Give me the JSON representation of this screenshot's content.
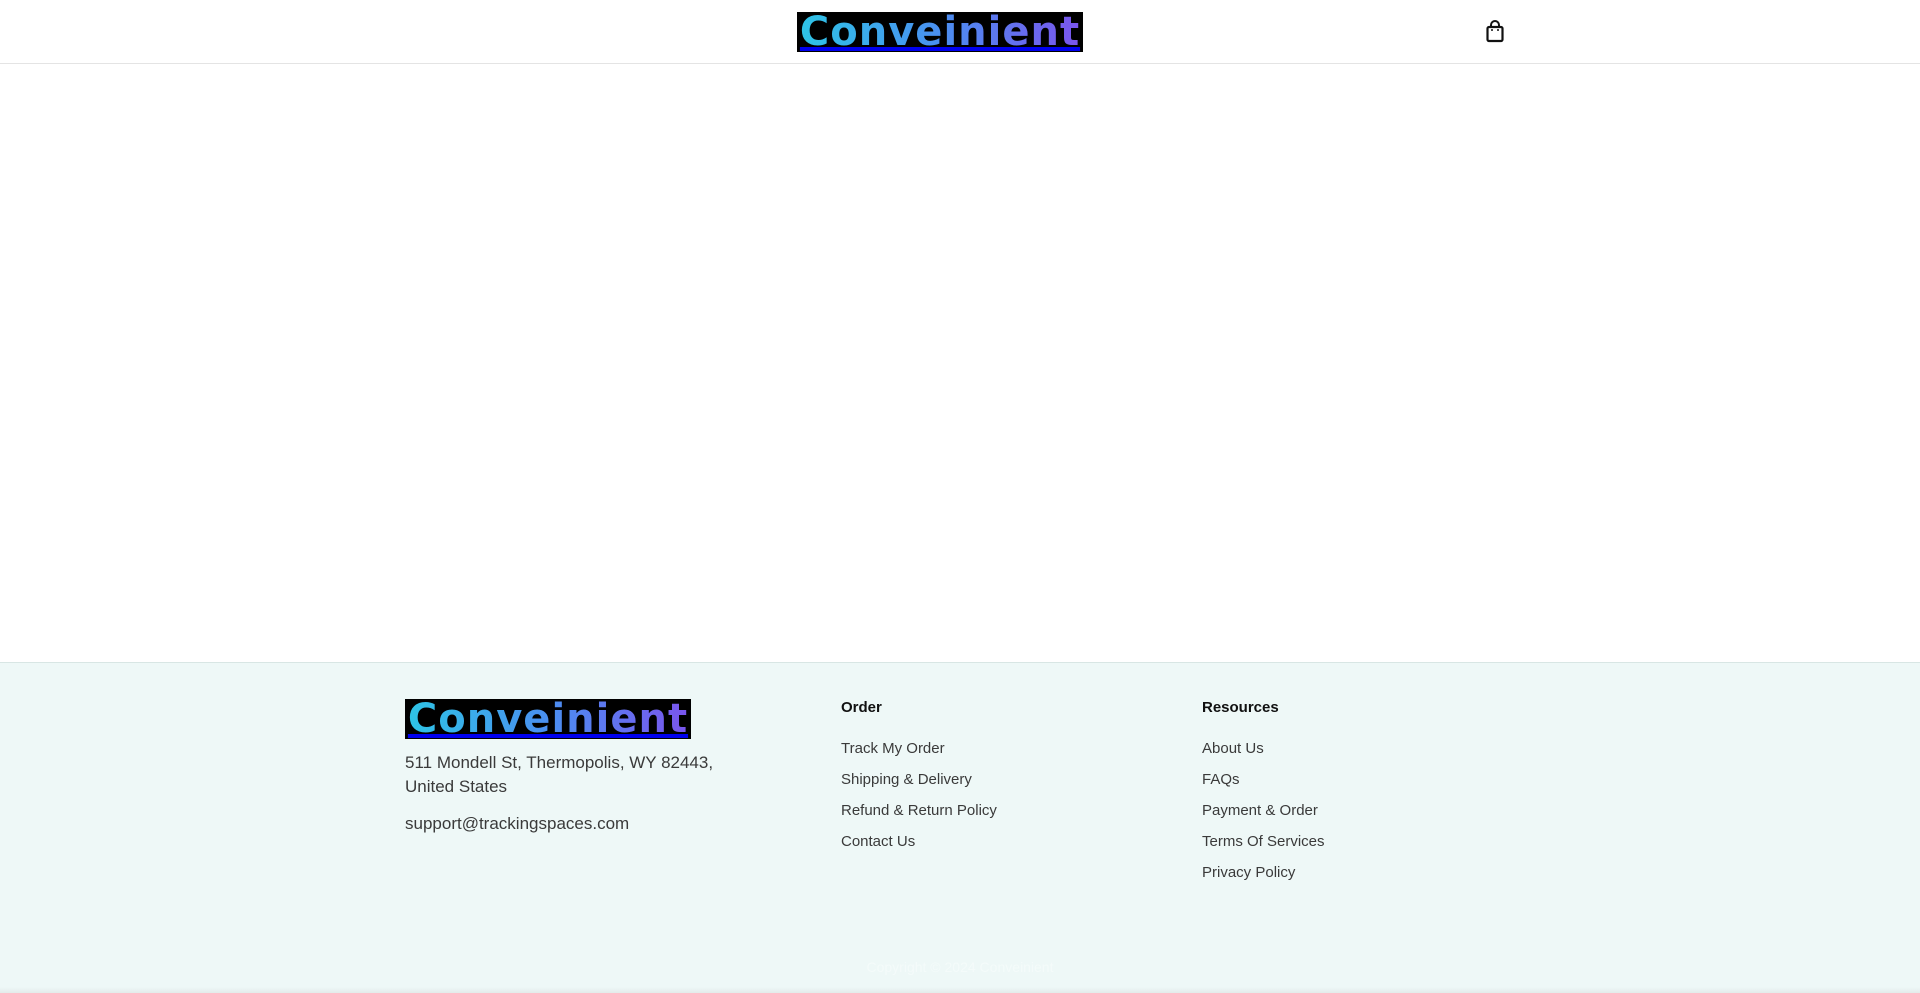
{
  "header": {
    "logo_text": "Conveinient",
    "cart_icon": "shopping-bag-icon"
  },
  "footer": {
    "logo_text": "Conveinient",
    "address": "511 Mondell St, Thermopolis, WY 82443, United States",
    "email": "support@trackingspaces.com",
    "order": {
      "heading": "Order",
      "links": [
        "Track My Order",
        "Shipping & Delivery",
        "Refund & Return Policy",
        "Contact Us"
      ]
    },
    "resources": {
      "heading": "Resources",
      "links": [
        "About Us",
        "FAQs",
        "Payment & Order",
        "Terms Of Services",
        "Privacy Policy"
      ]
    },
    "copyright": "Copyright © 2024 Conveinient"
  },
  "colors": {
    "footer_bg": "#eef8f7",
    "logo_gradient_start": "#2ec4e6",
    "logo_gradient_end": "#7a55ee"
  }
}
